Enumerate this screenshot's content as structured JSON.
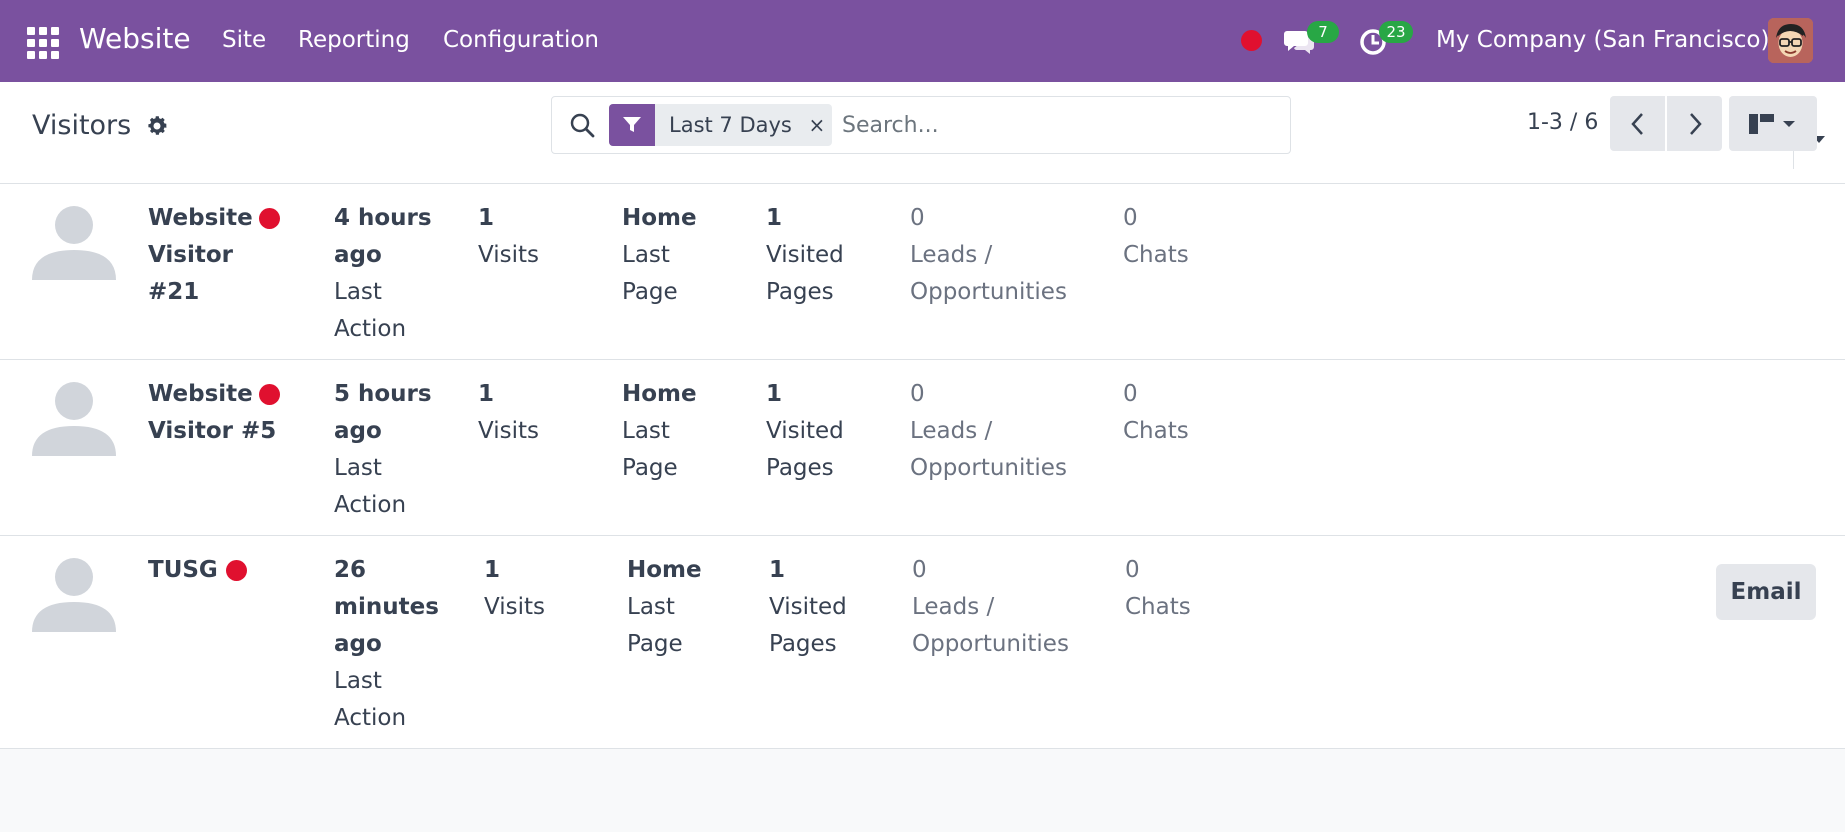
{
  "navbar": {
    "app_name": "Website",
    "menu": {
      "site": "Site",
      "reporting": "Reporting",
      "configuration": "Configuration"
    },
    "chat_count": "7",
    "activity_count": "23",
    "company": "My Company (San Francisco)",
    "accent_color": "#7a519f",
    "status_color": "#e0102f"
  },
  "control_panel": {
    "title": "Visitors",
    "search": {
      "facet_label": "Last 7 Days",
      "facet_remove": "×",
      "placeholder": "Search..."
    },
    "pager": "1-3 / 6"
  },
  "visitors": [
    {
      "name": "Website Visitor #21",
      "last_action_value": "4 hours ago",
      "last_action_label": "Last Action",
      "visits_value": "1",
      "visits_label": "Visits",
      "last_page_value": "Home",
      "last_page_label": "Last Page",
      "visited_pages_value": "1",
      "visited_pages_label": "Visited Pages",
      "leads_value": "0",
      "leads_label": "Leads / Opportunities",
      "chats_value": "0",
      "chats_label": "Chats"
    },
    {
      "name": "Website Visitor #5",
      "last_action_value": "5 hours ago",
      "last_action_label": "Last Action",
      "visits_value": "1",
      "visits_label": "Visits",
      "last_page_value": "Home",
      "last_page_label": "Last Page",
      "visited_pages_value": "1",
      "visited_pages_label": "Visited Pages",
      "leads_value": "0",
      "leads_label": "Leads / Opportunities",
      "chats_value": "0",
      "chats_label": "Chats"
    },
    {
      "name": "TUSG",
      "last_action_value": "26 minutes ago",
      "last_action_label": "Last Action",
      "visits_value": "1",
      "visits_label": "Visits",
      "last_page_value": "Home",
      "last_page_label": "Last Page",
      "visited_pages_value": "1",
      "visited_pages_label": "Visited Pages",
      "leads_value": "0",
      "leads_label": "Leads / Opportunities",
      "chats_value": "0",
      "chats_label": "Chats",
      "email_label": "Email"
    }
  ]
}
